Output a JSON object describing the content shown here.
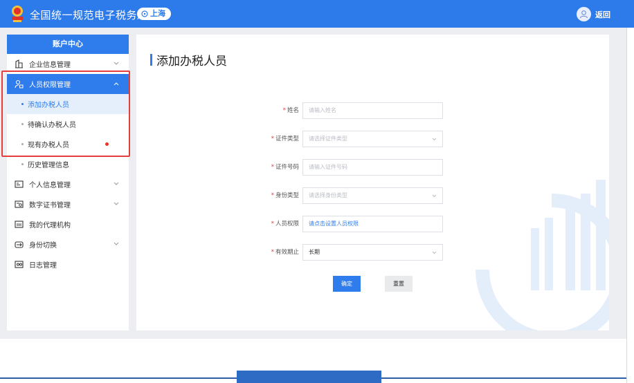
{
  "header": {
    "site_title": "全国统一规范电子税务局",
    "region": "上海",
    "back_label": "返回"
  },
  "sidebar": {
    "title": "账户中心",
    "items": [
      {
        "label": "企业信息管理",
        "icon": "building-icon",
        "expandable": true
      },
      {
        "label": "人员权限管理",
        "icon": "user-lock-icon",
        "expandable": true,
        "expanded": true,
        "children": [
          {
            "label": "添加办税人员",
            "active": true
          },
          {
            "label": "待确认办税人员"
          },
          {
            "label": "现有办税人员",
            "badge_dot": true
          }
        ]
      },
      {
        "label": "历史管理信息",
        "sub_style": true
      },
      {
        "label": "个人信息管理",
        "icon": "id-card-icon",
        "expandable": true
      },
      {
        "label": "数字证书管理",
        "icon": "certificate-icon",
        "expandable": true
      },
      {
        "label": "我的代理机构",
        "icon": "agency-icon"
      },
      {
        "label": "身份切换",
        "icon": "switch-identity-icon",
        "expandable": true
      },
      {
        "label": "日志管理",
        "icon": "log-icon"
      }
    ]
  },
  "main": {
    "page_title": "添加办税人员",
    "form": {
      "name": {
        "label": "姓名",
        "placeholder": "请输入姓名"
      },
      "id_type": {
        "label": "证件类型",
        "placeholder": "请选择证件类型"
      },
      "id_number": {
        "label": "证件号码",
        "placeholder": "请输入证件号码"
      },
      "identity_type": {
        "label": "身份类型",
        "placeholder": "请选择身份类型"
      },
      "permission": {
        "label": "人员权限",
        "link_text": "请点击设置人员权限"
      },
      "validity": {
        "label": "有效期止",
        "value": "长期"
      }
    },
    "confirm_label": "确定",
    "reset_label": "重置"
  },
  "colors": {
    "primary": "#2f7ded",
    "topbar": "#2d7bea",
    "required": "#e53c3c",
    "highlight_border": "#e53c3c",
    "badge_dot": "#e8332a"
  }
}
